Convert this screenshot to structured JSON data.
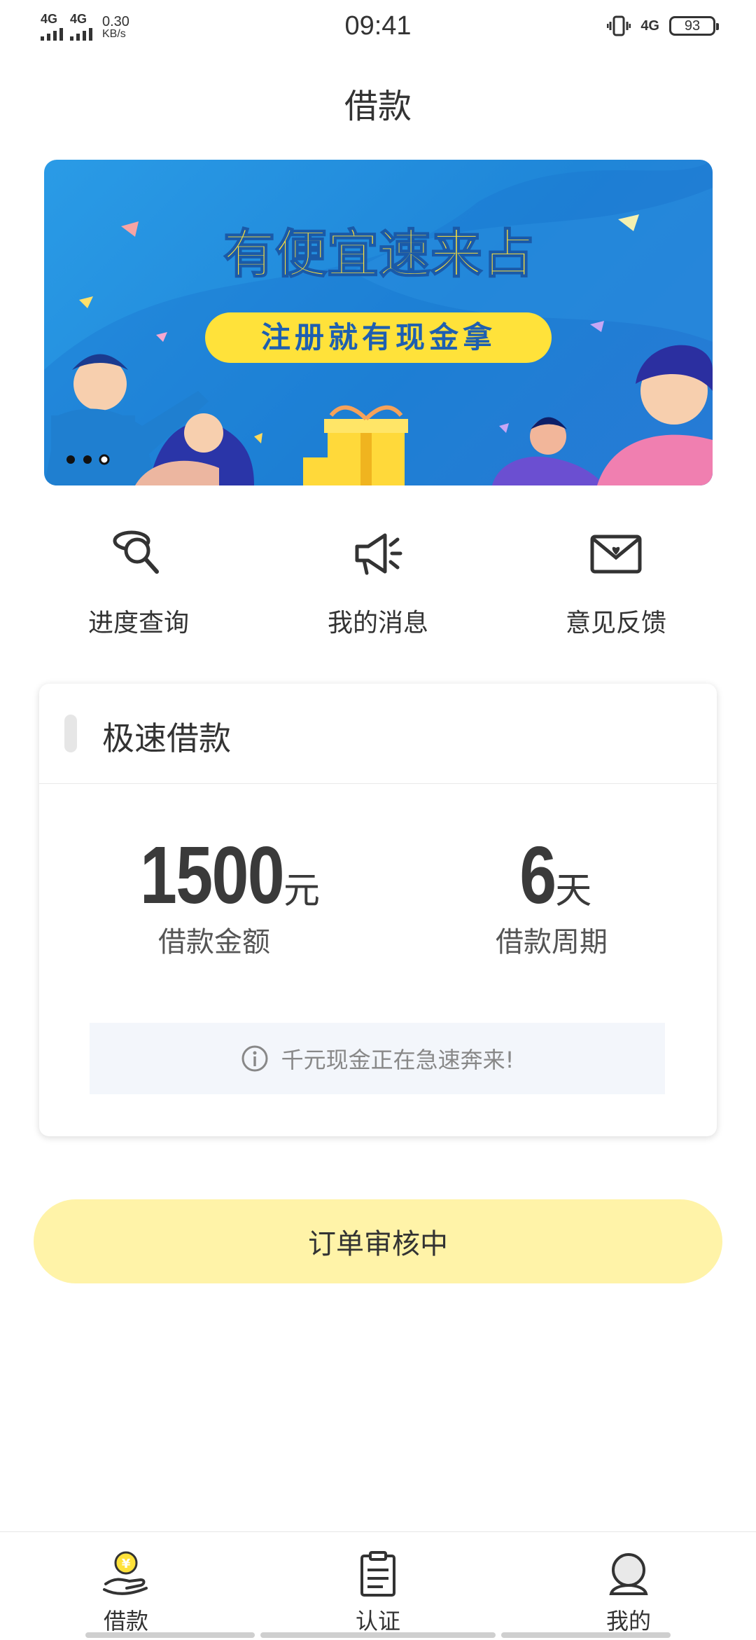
{
  "status_bar": {
    "signal1": "4G",
    "signal2": "4G",
    "speed_value": "0.30",
    "speed_unit": "KB/s",
    "time": "09:41",
    "network_right": "4G",
    "battery": "93"
  },
  "header": {
    "title": "借款"
  },
  "banner": {
    "headline": "有便宜速来占",
    "subline": "注册就有现金拿",
    "pages": 3,
    "active_page": 2
  },
  "quick_actions": [
    {
      "label": "进度查询",
      "icon": "search-icon"
    },
    {
      "label": "我的消息",
      "icon": "megaphone-icon"
    },
    {
      "label": "意见反馈",
      "icon": "heart-envelope-icon"
    }
  ],
  "loan_card": {
    "title": "极速借款",
    "amount": {
      "value": "1500",
      "unit": "元",
      "label": "借款金额"
    },
    "period": {
      "value": "6",
      "unit": "天",
      "label": "借款周期"
    },
    "notice": "千元现金正在急速奔来!"
  },
  "action_button": {
    "label": "订单审核中",
    "color": "#fff3a8"
  },
  "tabbar": {
    "items": [
      {
        "label": "借款",
        "icon": "coin-hand-icon",
        "active": true
      },
      {
        "label": "认证",
        "icon": "clipboard-icon",
        "active": false
      },
      {
        "label": "我的",
        "icon": "user-icon",
        "active": false
      }
    ]
  },
  "colors": {
    "accent": "#fff3a8",
    "banner_blue": "#1f86d8",
    "text": "#333333"
  }
}
